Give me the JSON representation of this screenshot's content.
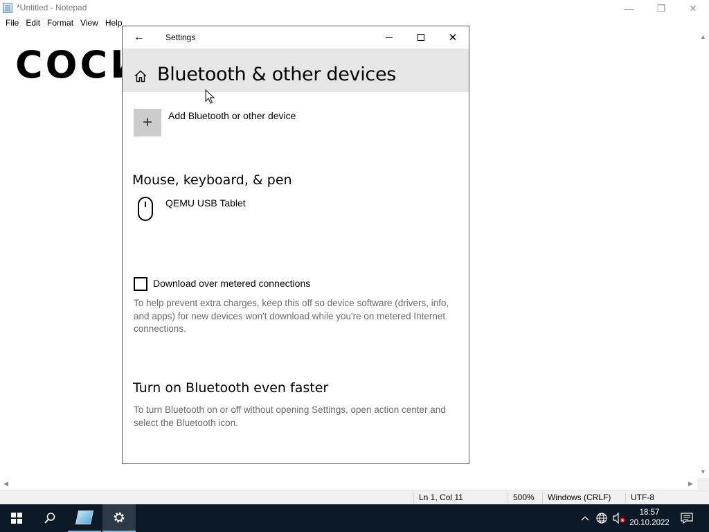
{
  "notepad": {
    "title": "*Untitled - Notepad",
    "menu": [
      "File",
      "Edit",
      "Format",
      "View",
      "Help"
    ],
    "content": "СОСИ",
    "status": {
      "position": "Ln 1, Col 11",
      "zoom": "500%",
      "line_ending": "Windows (CRLF)",
      "encoding": "UTF-8"
    }
  },
  "settings": {
    "title": "Settings",
    "heading": "Bluetooth & other devices",
    "add_device_label": "Add Bluetooth or other device",
    "add_device_symbol": "+",
    "section_mouse": "Mouse, keyboard, & pen",
    "device_name": "QEMU USB Tablet",
    "metered_label": "Download over metered connections",
    "metered_checked": false,
    "metered_desc": "To help prevent extra charges, keep this off so device software (drivers, info, and apps) for new devices won't download while you're on metered Internet connections.",
    "faster_heading": "Turn on Bluetooth even faster",
    "faster_desc": "To turn Bluetooth on or off without opening Settings, open action center and select the Bluetooth icon."
  },
  "taskbar": {
    "time": "18:57",
    "date": "20.10.2022",
    "accent": "#76b9ed",
    "background": "#0c1a27"
  }
}
